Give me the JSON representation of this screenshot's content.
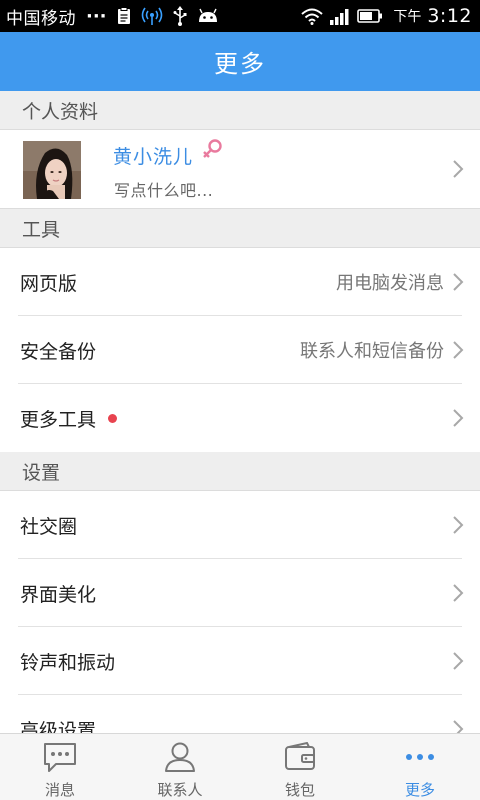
{
  "status_bar": {
    "carrier": "中国移动",
    "more_glyph": "···",
    "ampm": "下午",
    "time": "3:12",
    "icons": [
      "clipboard-icon",
      "wireless-signal-icon",
      "usb-icon",
      "android-icon",
      "wifi-icon",
      "cell-signal-icon",
      "battery-icon"
    ]
  },
  "header": {
    "title": "更多"
  },
  "sections": {
    "profile": {
      "header": "个人资料",
      "name": "黄小洗儿",
      "status": "写点什么吧..."
    },
    "tools": {
      "header": "工具",
      "items": [
        {
          "label": "网页版",
          "sub": "用电脑发消息"
        },
        {
          "label": "安全备份",
          "sub": "联系人和短信备份"
        },
        {
          "label": "更多工具",
          "sub": ""
        }
      ]
    },
    "settings": {
      "header": "设置",
      "items": [
        {
          "label": "社交圈"
        },
        {
          "label": "界面美化"
        },
        {
          "label": "铃声和振动"
        },
        {
          "label": "高级设置"
        }
      ]
    }
  },
  "bottom_nav": {
    "items": [
      {
        "label": "消息",
        "icon": "message-icon"
      },
      {
        "label": "联系人",
        "icon": "contact-icon"
      },
      {
        "label": "钱包",
        "icon": "wallet-icon"
      },
      {
        "label": "更多",
        "icon": "more-dots-icon"
      }
    ],
    "active": "更多"
  },
  "colors": {
    "accent": "#4099ee",
    "badge_dot": "#e8434f",
    "female": "#e97a9e"
  }
}
